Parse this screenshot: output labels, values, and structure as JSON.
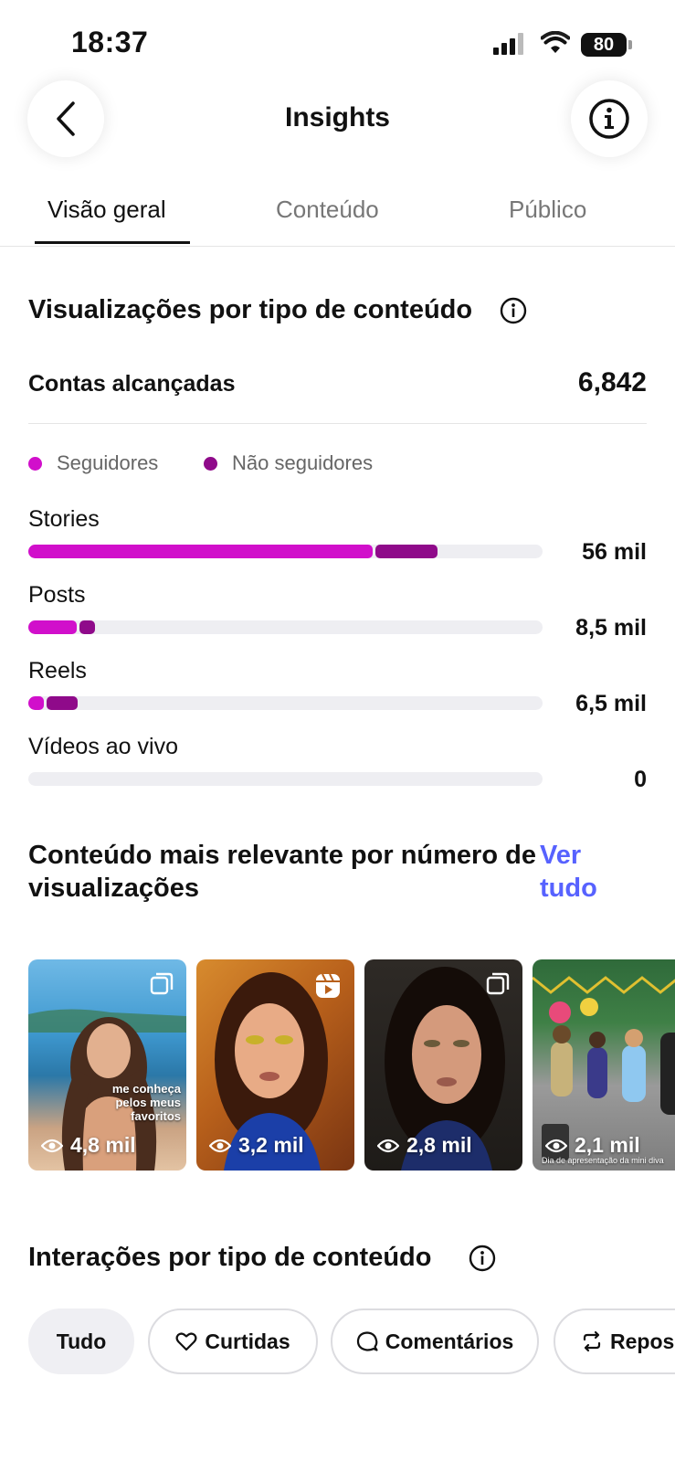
{
  "status": {
    "time": "18:37",
    "battery": "80"
  },
  "header": {
    "title": "Insights"
  },
  "tabs": [
    {
      "label": "Visão geral"
    },
    {
      "label": "Conteúdo"
    },
    {
      "label": "Público"
    }
  ],
  "views_section": {
    "title": "Visualizações por tipo de conteúdo",
    "reach_label": "Contas alcançadas",
    "reach_value": "6,842",
    "legend": [
      {
        "label": "Seguidores",
        "color": "#d10fcb"
      },
      {
        "label": "Não seguidores",
        "color": "#8f0a8a"
      }
    ],
    "rows": [
      {
        "label": "Stories",
        "value": "56 mil",
        "followers_fraction": 0.67,
        "non_followers_fraction": 0.12
      },
      {
        "label": "Posts",
        "value": "8,5 mil",
        "followers_fraction": 0.095,
        "non_followers_fraction": 0.03
      },
      {
        "label": "Reels",
        "value": "6,5 mil",
        "followers_fraction": 0.03,
        "non_followers_fraction": 0.06
      },
      {
        "label": "Vídeos ao vivo",
        "value": "0",
        "followers_fraction": 0,
        "non_followers_fraction": 0
      }
    ]
  },
  "relevant_section": {
    "title": "Conteúdo mais relevante por número de visualizações",
    "see_all": "Ver tudo",
    "items": [
      {
        "views": "4,8 mil",
        "type": "carousel-icon",
        "caption": "me conheça pelos meus favoritos"
      },
      {
        "views": "3,2 mil",
        "type": "reels-icon"
      },
      {
        "views": "2,8 mil",
        "type": "carousel-icon"
      },
      {
        "views": "2,1 mil",
        "type": "none",
        "caption": "Dia de apresentação da mini diva"
      }
    ]
  },
  "interactions_section": {
    "title": "Interações por tipo de conteúdo",
    "chips": [
      {
        "label": "Tudo",
        "icon": "none"
      },
      {
        "label": "Curtidas",
        "icon": "heart-icon"
      },
      {
        "label": "Comentários",
        "icon": "comment-icon"
      },
      {
        "label": "Repos",
        "icon": "repost-icon"
      }
    ]
  },
  "colors": {
    "accent_link": "#5762ff",
    "followers": "#d10fcb",
    "non_followers": "#8f0a8a"
  }
}
